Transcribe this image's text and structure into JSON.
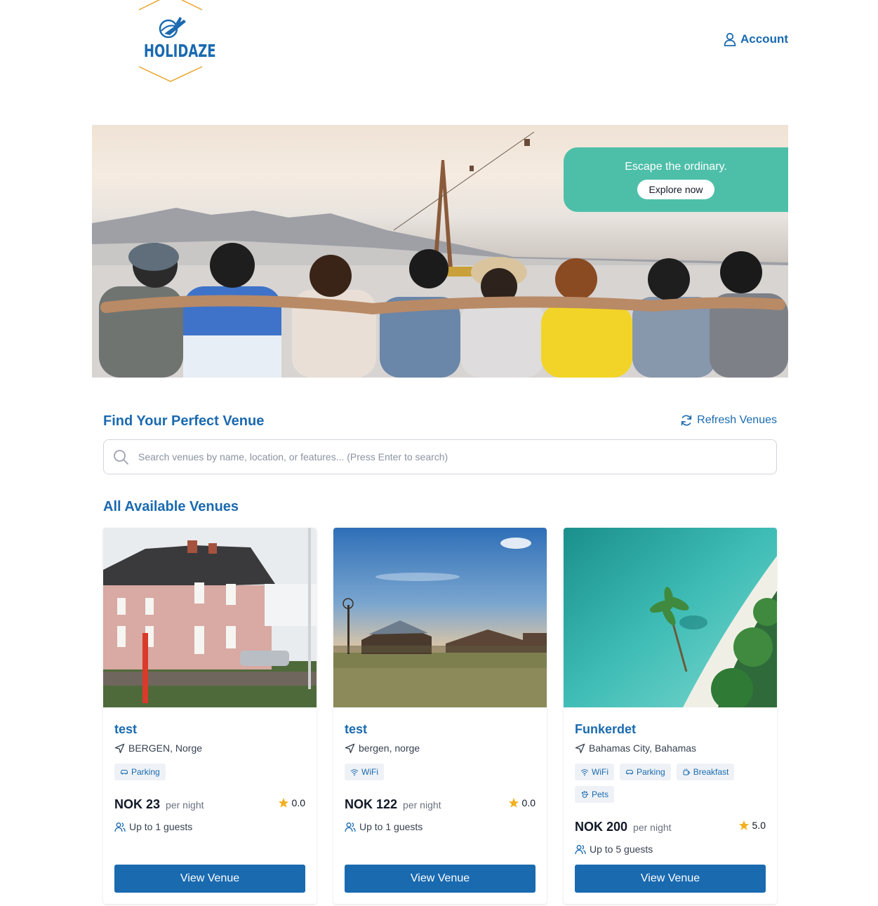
{
  "header": {
    "logo_text": "HOLIDAZE",
    "account_label": "Account"
  },
  "hero": {
    "tagline": "Escape the ordinary.",
    "cta_label": "Explore now"
  },
  "search": {
    "title": "Find Your Perfect Venue",
    "refresh_label": "Refresh Venues",
    "placeholder": "Search venues by name, location, or features... (Press Enter to search)"
  },
  "venues": {
    "title": "All Available Venues",
    "items": [
      {
        "name": "test",
        "location": "BERGEN, Norge",
        "amenities": [
          "Parking"
        ],
        "price": "NOK 23",
        "per_night": "per night",
        "rating": "0.0",
        "guests": "Up to 1 guests",
        "button": "View Venue"
      },
      {
        "name": "test",
        "location": "bergen, norge",
        "amenities": [
          "WiFi"
        ],
        "price": "NOK 122",
        "per_night": "per night",
        "rating": "0.0",
        "guests": "Up to 1 guests",
        "button": "View Venue"
      },
      {
        "name": "Funkerdet",
        "location": "Bahamas City, Bahamas",
        "amenities": [
          "WiFi",
          "Parking",
          "Breakfast",
          "Pets"
        ],
        "price": "NOK 200",
        "per_night": "per night",
        "rating": "5.0",
        "guests": "Up to 5 guests",
        "button": "View Venue"
      }
    ]
  },
  "colors": {
    "brand_blue": "#1a6ab0",
    "hero_accent": "#4dbfa9",
    "star": "#f2b01e"
  }
}
